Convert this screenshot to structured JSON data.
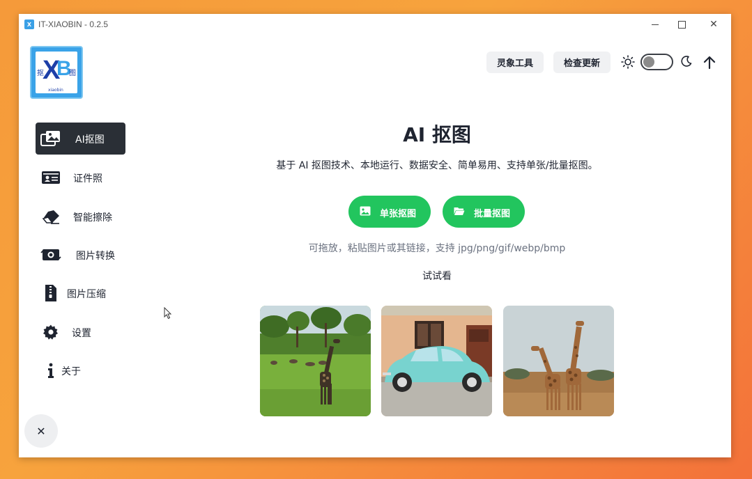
{
  "window": {
    "title": "IT-XIAOBIN - 0.2.5",
    "icon": "app-logo-icon"
  },
  "logo": {
    "letters": "XB",
    "left_char": "抠",
    "right_char": "图",
    "small_text": "xiaobin"
  },
  "toolbar": {
    "lingxiang_label": "灵象工具",
    "update_label": "检查更新",
    "theme_toggle": "off"
  },
  "sidebar": {
    "items": [
      {
        "label": "AI抠图",
        "icon": "image-gallery-icon",
        "active": true
      },
      {
        "label": "证件照",
        "icon": "id-card-icon",
        "active": false
      },
      {
        "label": "智能擦除",
        "icon": "eraser-icon",
        "active": false
      },
      {
        "label": "图片转换",
        "icon": "image-convert-icon",
        "active": false
      },
      {
        "label": "图片压缩",
        "icon": "file-zip-icon",
        "active": false
      },
      {
        "label": "设置",
        "icon": "gear-icon",
        "active": false
      },
      {
        "label": "关于",
        "icon": "info-icon",
        "active": false
      }
    ],
    "close_label": "✕"
  },
  "main": {
    "title": "AI 抠图",
    "subtitle": "基于 AI 抠图技术、本地运行、数据安全、简单易用、支持单张/批量抠图。",
    "single_button": "单张抠图",
    "batch_button": "批量抠图",
    "hint": "可拖放，粘贴图片或其链接，支持 jpg/png/gif/webp/bmp",
    "try_label": "试试看",
    "samples": [
      "giraffe-savanna",
      "vintage-car",
      "two-giraffes"
    ]
  },
  "colors": {
    "accent_green": "#22c55e",
    "sidebar_active": "#2a2f36",
    "logo_blue": "#3aa3e8"
  }
}
